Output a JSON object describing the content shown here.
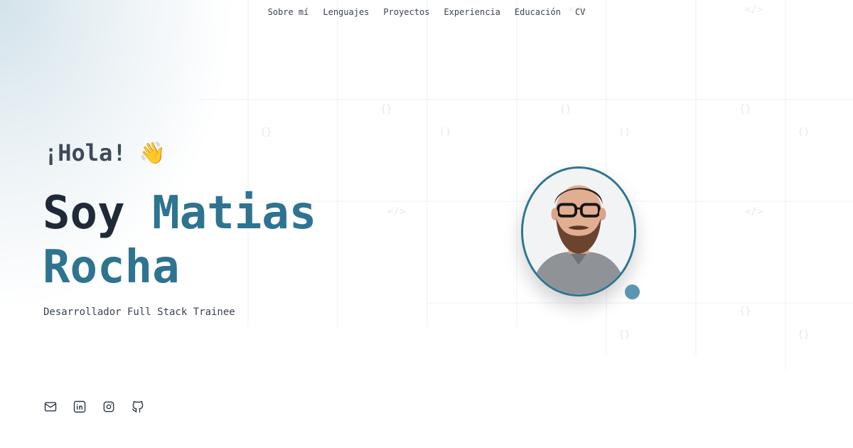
{
  "nav": {
    "items": [
      "Sobre mí",
      "Lenguajes",
      "Proyectos",
      "Experiencia",
      "Educación",
      "CV"
    ]
  },
  "hero": {
    "greeting": "¡Hola!",
    "wave_emoji": "👋",
    "name_prefix": "Soy",
    "first_name": "Matias",
    "last_name": "Rocha",
    "role": "Desarrollador Full Stack Trainee"
  },
  "social": [
    {
      "icon": "mail-icon"
    },
    {
      "icon": "linkedin-icon"
    },
    {
      "icon": "instagram-icon"
    },
    {
      "icon": "github-icon"
    }
  ],
  "colors": {
    "accent": "#2e7491",
    "text_dark": "#1f2937",
    "dot": "#5b95b1"
  }
}
